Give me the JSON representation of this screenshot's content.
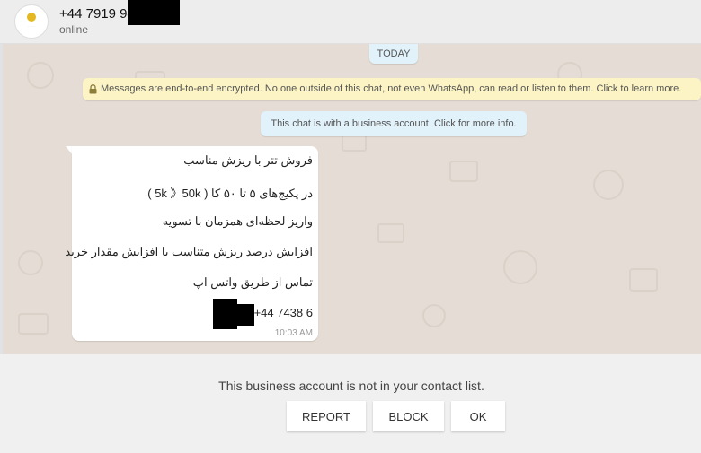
{
  "header": {
    "contact_name": "+44 7919 94",
    "status": "online"
  },
  "chat": {
    "date_label": "TODAY",
    "encryption_notice": "Messages are end-to-end encrypted. No one outside of this chat, not even WhatsApp, can read or listen to them. Click to learn more.",
    "business_notice": "This chat is with a business account. Click for more info.",
    "message": {
      "lines": [
        "فروش تتر با ریزش مناسب",
        "در پکیج‌های ۵ تا ۵۰ کا ( 5k 》50k )",
        "واریز لحظه‌ای همزمان با تسویه",
        "افزایش درصد ریزش متناسب با افزایش مقدار خرید",
        "تماس از طریق واتس اپ",
        "+44 7438 6"
      ],
      "time": "10:03 AM"
    }
  },
  "footer": {
    "notice": "This business account is not in your contact list.",
    "report_label": "REPORT",
    "block_label": "BLOCK",
    "ok_label": "OK"
  },
  "colors": {
    "chat_background": "#e5ddd5",
    "encryption_banner": "#fcf4c4",
    "system_bubble": "#e1f2fb",
    "header": "#ededed",
    "footer": "#f0f0f0"
  }
}
